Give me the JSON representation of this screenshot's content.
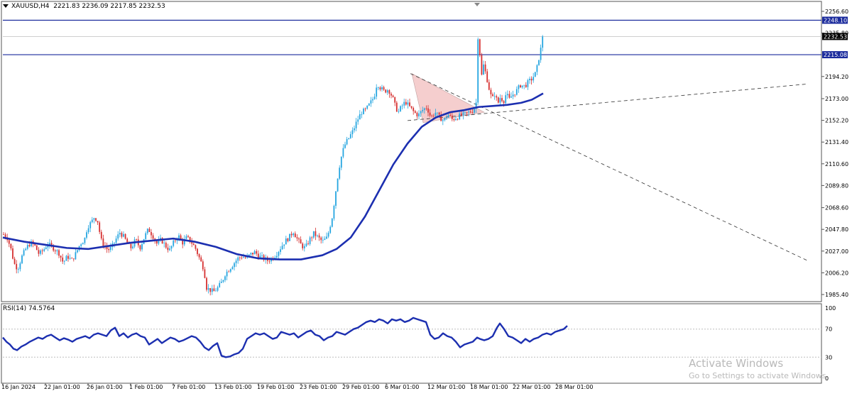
{
  "header": {
    "symbol": "XAUUSD,H4",
    "ohlc": "2221.83 2236.09 2217.85 2232.53"
  },
  "rsi_header": {
    "label": "RSI(14) 74.5764"
  },
  "price_axis": {
    "ticks": [
      "2256.60",
      "2235.80",
      "2194.20",
      "2173.00",
      "2152.20",
      "2131.40",
      "2110.60",
      "2089.80",
      "2068.60",
      "2047.80",
      "2027.00",
      "2006.20",
      "1985.40"
    ],
    "tick_values": [
      2256.6,
      2235.8,
      2194.2,
      2173.0,
      2152.2,
      2131.4,
      2110.6,
      2089.8,
      2068.6,
      2047.8,
      2027.0,
      2006.2,
      1985.4
    ],
    "labels": {
      "level_high": "2248.10",
      "current_price": "2232.53",
      "level_low": "2215.08"
    },
    "colors": {
      "level_line": "#1a2a9c",
      "level_label_bg": "#1a2a9c",
      "current_label_bg": "#000000"
    }
  },
  "rsi_axis": {
    "ticks": [
      "100",
      "70",
      "30",
      "0"
    ],
    "tick_values": [
      100,
      70,
      30,
      0
    ]
  },
  "time_axis": {
    "labels": [
      "16 Jan 2024",
      "22 Jan 01:00",
      "26 Jan 01:00",
      "1 Feb 01:00",
      "7 Feb 01:00",
      "13 Feb 01:00",
      "19 Feb 01:00",
      "23 Feb 01:00",
      "29 Feb 01:00",
      "6 Mar 01:00",
      "12 Mar 01:00",
      "18 Mar 01:00",
      "22 Mar 01:00",
      "28 Mar 01:00"
    ]
  },
  "watermark": {
    "line1": "Activate Windows",
    "line2": "Go to Settings to activate Windows."
  },
  "chart_data": [
    {
      "type": "candlestick",
      "symbol": "XAUUSD",
      "timeframe": "H4",
      "y_range": [
        1978,
        2262
      ],
      "colors": {
        "up": "#26a6e0",
        "down": "#d63030",
        "ma": "#1c2fb0"
      },
      "horizontal_levels": [
        2248.1,
        2215.08
      ],
      "close_path": [
        [
          0,
          2043
        ],
        [
          5,
          2040
        ],
        [
          10,
          2030
        ],
        [
          15,
          2015
        ],
        [
          20,
          2010
        ],
        [
          26,
          2022
        ],
        [
          32,
          2030
        ],
        [
          38,
          2035
        ],
        [
          44,
          2032
        ],
        [
          50,
          2024
        ],
        [
          56,
          2028
        ],
        [
          62,
          2034
        ],
        [
          70,
          2030
        ],
        [
          78,
          2025
        ],
        [
          84,
          2016
        ],
        [
          90,
          2022
        ],
        [
          96,
          2018
        ],
        [
          102,
          2025
        ],
        [
          108,
          2034
        ],
        [
          114,
          2038
        ],
        [
          118,
          2050
        ],
        [
          124,
          2055
        ],
        [
          128,
          2060
        ],
        [
          133,
          2055
        ],
        [
          137,
          2038
        ],
        [
          142,
          2032
        ],
        [
          147,
          2028
        ],
        [
          152,
          2030
        ],
        [
          158,
          2038
        ],
        [
          164,
          2045
        ],
        [
          170,
          2040
        ],
        [
          176,
          2032
        ],
        [
          180,
          2030
        ],
        [
          186,
          2038
        ],
        [
          192,
          2030
        ],
        [
          198,
          2040
        ],
        [
          204,
          2048
        ],
        [
          210,
          2042
        ],
        [
          216,
          2034
        ],
        [
          222,
          2038
        ],
        [
          228,
          2032
        ],
        [
          234,
          2028
        ],
        [
          240,
          2036
        ],
        [
          246,
          2042
        ],
        [
          252,
          2035
        ],
        [
          258,
          2040
        ],
        [
          264,
          2036
        ],
        [
          270,
          2030
        ],
        [
          276,
          2020
        ],
        [
          282,
          2010
        ],
        [
          286,
          1992
        ],
        [
          290,
          1990
        ],
        [
          296,
          1988
        ],
        [
          302,
          1992
        ],
        [
          308,
          1998
        ],
        [
          312,
          2005
        ],
        [
          318,
          2010
        ],
        [
          324,
          2015
        ],
        [
          330,
          2020
        ],
        [
          336,
          2022
        ],
        [
          342,
          2020
        ],
        [
          348,
          2024
        ],
        [
          354,
          2026
        ],
        [
          360,
          2022
        ],
        [
          366,
          2020
        ],
        [
          372,
          2018
        ],
        [
          378,
          2020
        ],
        [
          384,
          2024
        ],
        [
          390,
          2030
        ],
        [
          396,
          2036
        ],
        [
          402,
          2040
        ],
        [
          408,
          2046
        ],
        [
          414,
          2038
        ],
        [
          420,
          2032
        ],
        [
          425,
          2030
        ],
        [
          431,
          2038
        ],
        [
          437,
          2044
        ],
        [
          443,
          2040
        ],
        [
          449,
          2036
        ],
        [
          456,
          2040
        ],
        [
          463,
          2060
        ],
        [
          468,
          2085
        ],
        [
          472,
          2105
        ],
        [
          476,
          2118
        ],
        [
          480,
          2128
        ],
        [
          486,
          2135
        ],
        [
          492,
          2142
        ],
        [
          498,
          2152
        ],
        [
          504,
          2160
        ],
        [
          510,
          2162
        ],
        [
          516,
          2168
        ],
        [
          522,
          2175
        ],
        [
          526,
          2188
        ],
        [
          530,
          2184
        ],
        [
          536,
          2180
        ],
        [
          542,
          2182
        ],
        [
          548,
          2174
        ],
        [
          552,
          2165
        ],
        [
          556,
          2160
        ],
        [
          560,
          2165
        ],
        [
          566,
          2170
        ],
        [
          572,
          2165
        ],
        [
          578,
          2160
        ],
        [
          584,
          2157
        ],
        [
          590,
          2162
        ],
        [
          596,
          2165
        ],
        [
          602,
          2155
        ],
        [
          608,
          2160
        ],
        [
          614,
          2155
        ],
        [
          620,
          2152
        ],
        [
          626,
          2158
        ],
        [
          632,
          2153
        ],
        [
          638,
          2155
        ],
        [
          644,
          2157
        ],
        [
          650,
          2158
        ],
        [
          656,
          2160
        ],
        [
          662,
          2162
        ],
        [
          666,
          2170
        ],
        [
          669,
          2255
        ],
        [
          672,
          2190
        ],
        [
          676,
          2205
        ],
        [
          680,
          2195
        ],
        [
          684,
          2182
        ],
        [
          688,
          2172
        ],
        [
          692,
          2178
        ],
        [
          696,
          2168
        ],
        [
          700,
          2175
        ],
        [
          704,
          2170
        ],
        [
          708,
          2178
        ],
        [
          712,
          2172
        ],
        [
          716,
          2176
        ],
        [
          722,
          2180
        ],
        [
          728,
          2186
        ],
        [
          734,
          2185
        ],
        [
          738,
          2188
        ],
        [
          744,
          2192
        ],
        [
          750,
          2198
        ],
        [
          754,
          2212
        ],
        [
          758,
          2225
        ],
        [
          761,
          2232.53
        ]
      ],
      "ma_path": [
        [
          0,
          2040
        ],
        [
          30,
          2036
        ],
        [
          60,
          2033
        ],
        [
          90,
          2030
        ],
        [
          120,
          2029
        ],
        [
          150,
          2032
        ],
        [
          180,
          2035
        ],
        [
          210,
          2037
        ],
        [
          240,
          2039
        ],
        [
          270,
          2036
        ],
        [
          300,
          2031
        ],
        [
          330,
          2024
        ],
        [
          360,
          2020
        ],
        [
          390,
          2019
        ],
        [
          420,
          2019
        ],
        [
          450,
          2023
        ],
        [
          470,
          2029
        ],
        [
          490,
          2040
        ],
        [
          510,
          2060
        ],
        [
          530,
          2085
        ],
        [
          550,
          2110
        ],
        [
          570,
          2130
        ],
        [
          590,
          2146
        ],
        [
          610,
          2155
        ],
        [
          630,
          2160
        ],
        [
          650,
          2162
        ],
        [
          670,
          2165
        ],
        [
          690,
          2166
        ],
        [
          710,
          2167
        ],
        [
          730,
          2169
        ],
        [
          745,
          2172
        ],
        [
          761,
          2178
        ]
      ],
      "trendlines": [
        {
          "style": "dashed",
          "points": [
            [
              578,
              2197
            ],
            [
              1137,
              2018
            ]
          ]
        },
        {
          "style": "dashed",
          "points": [
            [
              574,
              2152
            ],
            [
              1137,
              2187
            ]
          ]
        }
      ],
      "triangle_pattern": {
        "points": [
          [
            580,
            2197
          ],
          [
            682,
            2160
          ],
          [
            596,
            2150
          ]
        ],
        "fill": "#f3c6c6"
      }
    },
    {
      "type": "line",
      "indicator": "RSI(14)",
      "value": 74.5764,
      "y_range": [
        0,
        100
      ],
      "levels": [
        70,
        30
      ],
      "path": [
        [
          0,
          58
        ],
        [
          5,
          52
        ],
        [
          10,
          48
        ],
        [
          15,
          42
        ],
        [
          20,
          40
        ],
        [
          26,
          45
        ],
        [
          32,
          48
        ],
        [
          38,
          52
        ],
        [
          44,
          55
        ],
        [
          50,
          58
        ],
        [
          56,
          56
        ],
        [
          62,
          60
        ],
        [
          68,
          62
        ],
        [
          74,
          58
        ],
        [
          80,
          54
        ],
        [
          86,
          57
        ],
        [
          92,
          55
        ],
        [
          98,
          52
        ],
        [
          104,
          56
        ],
        [
          110,
          58
        ],
        [
          116,
          60
        ],
        [
          122,
          57
        ],
        [
          128,
          62
        ],
        [
          134,
          64
        ],
        [
          140,
          62
        ],
        [
          146,
          60
        ],
        [
          152,
          68
        ],
        [
          158,
          72
        ],
        [
          164,
          60
        ],
        [
          170,
          64
        ],
        [
          176,
          58
        ],
        [
          182,
          62
        ],
        [
          188,
          64
        ],
        [
          194,
          60
        ],
        [
          200,
          58
        ],
        [
          206,
          48
        ],
        [
          212,
          52
        ],
        [
          218,
          56
        ],
        [
          224,
          50
        ],
        [
          230,
          54
        ],
        [
          236,
          58
        ],
        [
          242,
          56
        ],
        [
          248,
          52
        ],
        [
          254,
          54
        ],
        [
          260,
          57
        ],
        [
          266,
          60
        ],
        [
          272,
          58
        ],
        [
          278,
          52
        ],
        [
          284,
          44
        ],
        [
          290,
          40
        ],
        [
          296,
          46
        ],
        [
          302,
          50
        ],
        [
          308,
          32
        ],
        [
          314,
          30
        ],
        [
          320,
          31
        ],
        [
          326,
          34
        ],
        [
          332,
          36
        ],
        [
          338,
          42
        ],
        [
          344,
          56
        ],
        [
          350,
          60
        ],
        [
          356,
          64
        ],
        [
          362,
          62
        ],
        [
          368,
          64
        ],
        [
          374,
          60
        ],
        [
          380,
          56
        ],
        [
          386,
          58
        ],
        [
          392,
          66
        ],
        [
          398,
          64
        ],
        [
          404,
          62
        ],
        [
          410,
          64
        ],
        [
          416,
          58
        ],
        [
          422,
          62
        ],
        [
          428,
          66
        ],
        [
          434,
          68
        ],
        [
          440,
          62
        ],
        [
          446,
          60
        ],
        [
          452,
          54
        ],
        [
          458,
          58
        ],
        [
          464,
          60
        ],
        [
          470,
          66
        ],
        [
          476,
          64
        ],
        [
          482,
          62
        ],
        [
          488,
          66
        ],
        [
          494,
          70
        ],
        [
          500,
          72
        ],
        [
          506,
          76
        ],
        [
          512,
          80
        ],
        [
          518,
          82
        ],
        [
          524,
          80
        ],
        [
          530,
          84
        ],
        [
          536,
          82
        ],
        [
          542,
          78
        ],
        [
          548,
          84
        ],
        [
          554,
          82
        ],
        [
          560,
          84
        ],
        [
          566,
          80
        ],
        [
          572,
          82
        ],
        [
          578,
          86
        ],
        [
          584,
          84
        ],
        [
          590,
          82
        ],
        [
          596,
          80
        ],
        [
          602,
          62
        ],
        [
          608,
          56
        ],
        [
          614,
          58
        ],
        [
          620,
          64
        ],
        [
          626,
          60
        ],
        [
          632,
          58
        ],
        [
          638,
          52
        ],
        [
          644,
          44
        ],
        [
          650,
          48
        ],
        [
          656,
          50
        ],
        [
          662,
          52
        ],
        [
          668,
          58
        ],
        [
          672,
          56
        ],
        [
          678,
          54
        ],
        [
          684,
          56
        ],
        [
          690,
          60
        ],
        [
          696,
          72
        ],
        [
          700,
          78
        ],
        [
          706,
          70
        ],
        [
          712,
          60
        ],
        [
          718,
          58
        ],
        [
          724,
          54
        ],
        [
          730,
          50
        ],
        [
          736,
          56
        ],
        [
          742,
          52
        ],
        [
          748,
          56
        ],
        [
          754,
          58
        ],
        [
          760,
          62
        ],
        [
          766,
          64
        ],
        [
          772,
          62
        ],
        [
          778,
          66
        ],
        [
          784,
          68
        ],
        [
          790,
          70
        ],
        [
          795,
          74.58
        ]
      ]
    }
  ]
}
